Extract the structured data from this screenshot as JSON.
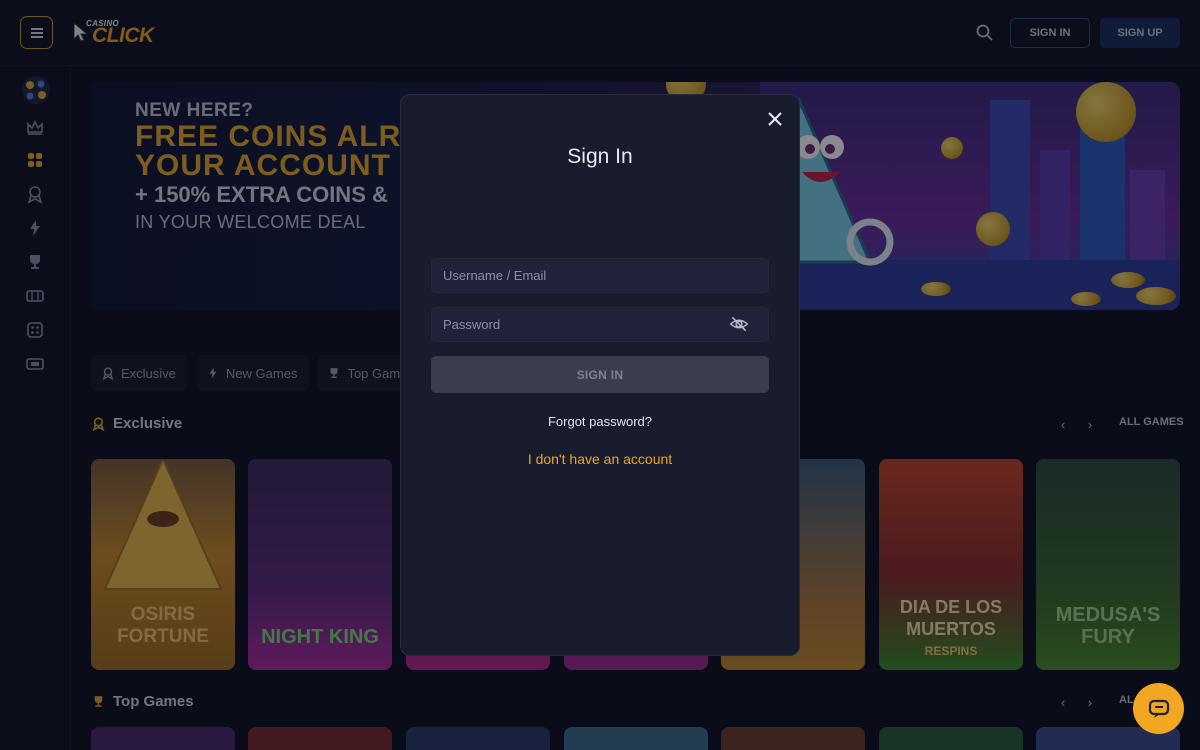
{
  "header": {
    "logo_small": "CASINO",
    "logo_big": "CLICK",
    "sign_in_label": "SIGN IN",
    "sign_up_label": "SIGN UP"
  },
  "sidebar": {
    "icons": [
      "lobby-icon",
      "crown-icon",
      "grid-icon",
      "exclusive-icon",
      "lightning-icon",
      "trophy-icon",
      "slots-icon",
      "table-games-icon",
      "ticket-icon"
    ]
  },
  "banner": {
    "line1": "NEW HERE?",
    "line2": "FREE COINS ALR",
    "line2b": "YOUR ACCOUNT",
    "line3": "+ 150% EXTRA COINS &",
    "line4": "IN YOUR WELCOME DEAL"
  },
  "chips": [
    {
      "label": "Exclusive",
      "icon": "exclusive-icon"
    },
    {
      "label": "New Games",
      "icon": "lightning-icon"
    },
    {
      "label": "Top Game",
      "icon": "trophy-icon"
    }
  ],
  "sections": {
    "exclusive": {
      "title": "Exclusive",
      "all_label": "ALL GAMES"
    },
    "top": {
      "title": "Top Games",
      "all_label": "AL"
    }
  },
  "games": [
    {
      "title": "OSIRIS FORTUNE",
      "color": "#c98a2a"
    },
    {
      "title": "NIGHT KING",
      "color": "#7a2f9a"
    },
    {
      "title": "",
      "color": "#b02a8a"
    },
    {
      "title": "",
      "color": "#9a2a8a"
    },
    {
      "title": "",
      "color": "#c2892a"
    },
    {
      "title": "DIA DE LOS MUERTOS",
      "subtitle": "RESPINS",
      "color": "#3a8a2a"
    },
    {
      "title": "MEDUSA'S FURY",
      "color": "#3a6a2a"
    }
  ],
  "modal": {
    "title": "Sign In",
    "username_placeholder": "Username / Email",
    "password_placeholder": "Password",
    "submit_label": "SIGN IN",
    "forgot_label": "Forgot password?",
    "no_account_label": "I don't have an account"
  },
  "colors": {
    "accent": "#e8a426",
    "background": "#0c1120",
    "modal": "#191c2d"
  }
}
